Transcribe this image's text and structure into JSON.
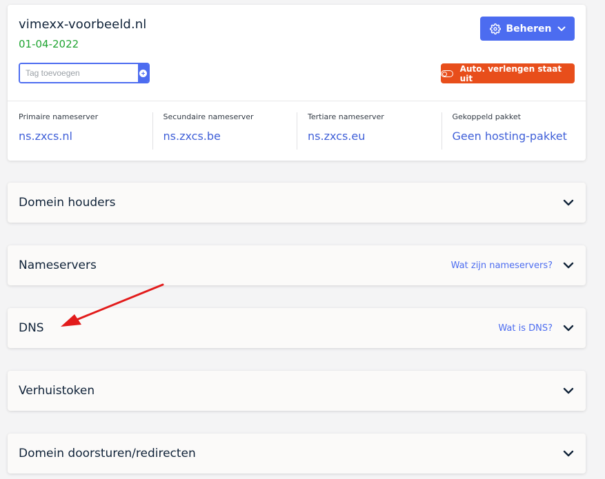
{
  "domain": {
    "name": "vimexx-voorbeeld.nl",
    "date": "01-04-2022",
    "tag_placeholder": "Tag toevoegen",
    "manage_label": "Beheren",
    "auto_renew_label": "Auto. verlengen staat uit"
  },
  "nameservers": [
    {
      "label": "Primaire nameserver",
      "value": "ns.zxcs.nl"
    },
    {
      "label": "Secundaire nameserver",
      "value": "ns.zxcs.be"
    },
    {
      "label": "Tertiare nameserver",
      "value": "ns.zxcs.eu"
    },
    {
      "label": "Gekoppeld pakket",
      "value": "Geen hosting-pakket"
    }
  ],
  "sections": [
    {
      "title": "Domein houders",
      "link": ""
    },
    {
      "title": "Nameservers",
      "link": "Wat zijn nameservers?"
    },
    {
      "title": "DNS",
      "link": "Wat is DNS?"
    },
    {
      "title": "Verhuistoken",
      "link": ""
    },
    {
      "title": "Domein doorsturen/redirecten",
      "link": ""
    }
  ],
  "colors": {
    "accent": "#4c6cf0",
    "date_green": "#1fa431",
    "auto_renew_off": "#e84e1b",
    "annotation_arrow": "#e21b1b"
  },
  "icons": {
    "manage": "gear-icon",
    "manage_caret": "chevron-down-icon",
    "tag_add": "plus-circle-icon",
    "auto_renew": "toggle-off-icon",
    "section": "chevron-down-icon"
  }
}
